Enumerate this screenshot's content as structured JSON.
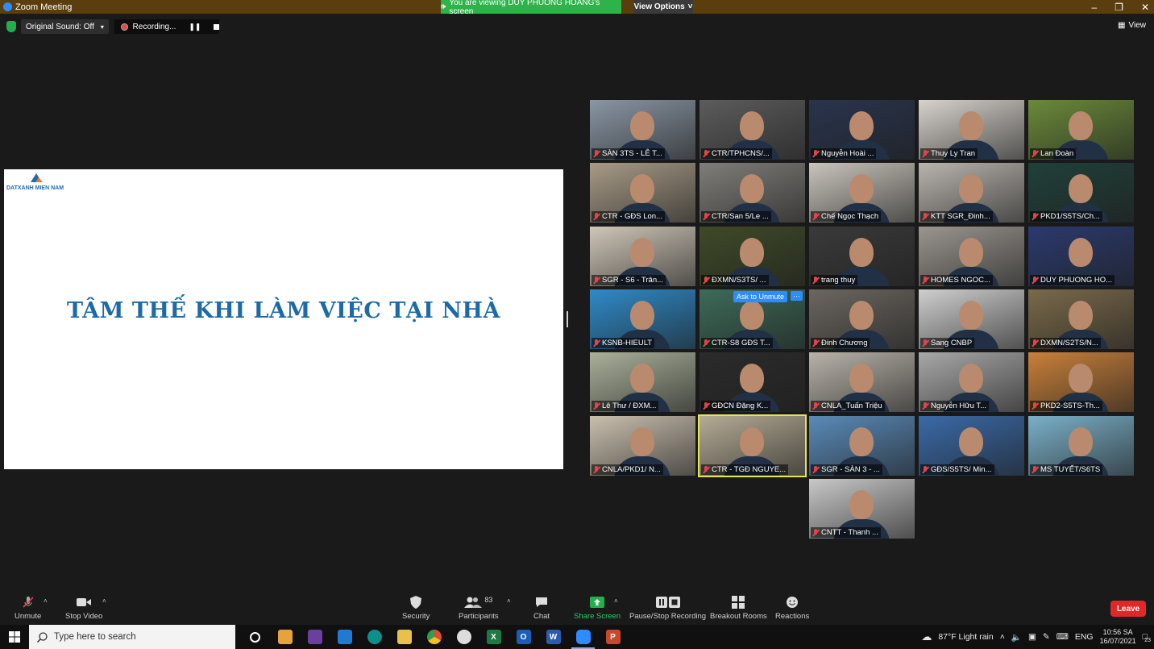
{
  "window": {
    "title": "Zoom Meeting",
    "viewing_banner": "You are viewing DUY PHUONG HOANG's screen",
    "view_options": "View Options",
    "controls": [
      "–",
      "❐",
      "✕"
    ]
  },
  "topbar": {
    "original_sound": "Original Sound: Off",
    "recording": "Recording...",
    "view_label": "View"
  },
  "slide": {
    "logo_text": "DATXANH MIEN NAM",
    "title": "TÂM THẾ KHI LÀM VIỆC TẠI NHÀ"
  },
  "participants": [
    {
      "name": "SÀN 3TS - LÊ T...",
      "bg": "#8a96a4"
    },
    {
      "name": "CTR/TPHCNS/...",
      "bg": "#5c5c5c"
    },
    {
      "name": "Nguyễn Hoài ...",
      "bg": "#29344d"
    },
    {
      "name": "Thuy Ly Tran",
      "bg": "#d7d2cc"
    },
    {
      "name": "Lan Đoàn",
      "bg": "#6b8a3a"
    },
    {
      "name": "CTR - GĐS Lon...",
      "bg": "#a89b87"
    },
    {
      "name": "CTR/San 5/Le ...",
      "bg": "#807e7a"
    },
    {
      "name": "Chế Ngọc Thạch",
      "bg": "#c9c4bc"
    },
    {
      "name": "KTT SGR_Đinh...",
      "bg": "#b9b4ae"
    },
    {
      "name": "PKD1/S5TS/Ch...",
      "bg": "#21403a"
    },
    {
      "name": "SGR - S6 - Trân...",
      "bg": "#cfc6b8"
    },
    {
      "name": "ĐXMN/S3TS/ ...",
      "bg": "#3f4a28"
    },
    {
      "name": "trang thuy",
      "bg": "#3a3a3a"
    },
    {
      "name": "HOMES NGOC...",
      "bg": "#9a958f"
    },
    {
      "name": "DUY PHUONG HO...",
      "bg": "#2b3a6e"
    },
    {
      "name": "KSNB-HIEULT",
      "bg": "#2f8ac8"
    },
    {
      "name": "CTR-S8 GĐS T...",
      "bg": "#3d6b5a"
    },
    {
      "name": "Đinh Chương",
      "bg": "#6b6660"
    },
    {
      "name": "Sang CNBP",
      "bg": "#cfcfcf"
    },
    {
      "name": "DXMN/S2TS/N...",
      "bg": "#7a6a4a"
    },
    {
      "name": "Lê Thư / ĐXM...",
      "bg": "#a9b09a"
    },
    {
      "name": "GĐCN Đặng K...",
      "bg": "#2b2b2b"
    },
    {
      "name": "CNLA_Tuấn Triệu",
      "bg": "#b8b2a9"
    },
    {
      "name": "Nguyễn Hữu T...",
      "bg": "#a8a8a8"
    },
    {
      "name": "PKD2-S5TS-Th...",
      "bg": "#c8803a"
    },
    {
      "name": "CNLA/PKD1/ N...",
      "bg": "#c9bfae"
    },
    {
      "name": "CTR - TGĐ NGUYE...",
      "bg": "#b5ab95"
    },
    {
      "name": "SGR - SÀN 3 - ...",
      "bg": "#5a8ab8"
    },
    {
      "name": "GĐS/S5TS/ Min...",
      "bg": "#3a6aa8"
    },
    {
      "name": "MS TUYẾT/S6TS",
      "bg": "#7ab0c8"
    },
    {
      "name": "CNTT - Thanh ...",
      "bg": "#c8c8c8"
    }
  ],
  "tile_overlay": {
    "ask_unmute": "Ask to Unmute",
    "more": "···"
  },
  "toolbar": {
    "unmute": "Unmute",
    "stop_video": "Stop Video",
    "security": "Security",
    "participants": "Participants",
    "participants_count": "83",
    "chat": "Chat",
    "share_screen": "Share Screen",
    "pause_stop_recording": "Pause/Stop Recording",
    "breakout_rooms": "Breakout Rooms",
    "reactions": "Reactions",
    "leave": "Leave",
    "share_color": "#22b04c"
  },
  "taskbar": {
    "search_placeholder": "Type here to search",
    "weather": "87°F  Light rain",
    "language": "ENG",
    "time": "10:56 SA",
    "date": "16/07/2021",
    "notifications": "23"
  }
}
